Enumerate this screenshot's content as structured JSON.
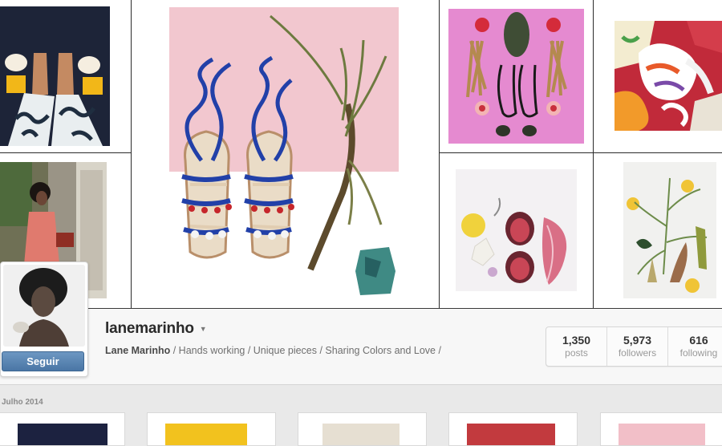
{
  "profile": {
    "username": "lanemarinho",
    "full_name": "Lane Marinho",
    "bio": " / Hands working / Unique pieces / Sharing Colors and Love /",
    "follow_label": "Seguir"
  },
  "stats": [
    {
      "value": "1,350",
      "label": "posts"
    },
    {
      "value": "5,973",
      "label": "followers"
    },
    {
      "value": "616",
      "label": "following"
    }
  ],
  "feed": {
    "month_label": "Julho 2014"
  },
  "colors": {
    "follow_button": "#5583b3",
    "text_dark": "#2a2a2a",
    "text_muted": "#6f6f6f",
    "tile_pink": "#f3c8cf",
    "tile_magenta": "#e58ad0"
  }
}
